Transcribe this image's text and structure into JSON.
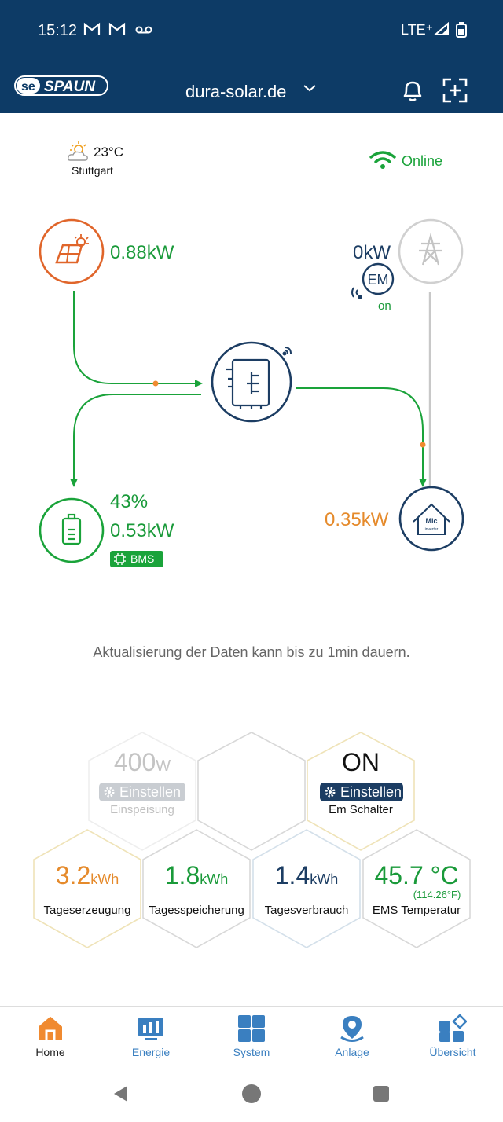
{
  "status": {
    "time": "15:12",
    "network": "LTE⁺"
  },
  "header": {
    "site": "dura-solar.de",
    "brand": "SPAUN"
  },
  "weather": {
    "temperature": "23°C",
    "city": "Stuttgart"
  },
  "connection": {
    "status": "Online"
  },
  "flow": {
    "pv_power": "0.88kW",
    "grid_power": "0kW",
    "em_label": "EM",
    "em_state": "on",
    "battery_soc": "43%",
    "battery_power": "0.53kW",
    "bms_label": "BMS",
    "home_power": "0.35kW",
    "home_icon_text": "Mic",
    "home_icon_sub": "inverter"
  },
  "note": "Aktualisierung der Daten kann bis zu 1min dauern.",
  "tiles": {
    "feed_in": {
      "value": "400",
      "unit": "W",
      "button": "Einstellen",
      "label": "Einspeisung"
    },
    "em_switch": {
      "value": "ON",
      "button": "Einstellen",
      "label": "Em Schalter"
    },
    "gen": {
      "value": "3.2",
      "unit": "kWh",
      "label": "Tageserzeugung"
    },
    "store": {
      "value": "1.8",
      "unit": "kWh",
      "label": "Tagesspeicherung"
    },
    "cons": {
      "value": "1.4",
      "unit": "kWh",
      "label": "Tagesverbrauch"
    },
    "ems_temp": {
      "value": "45.7 °C",
      "sub": "(114.26°F)",
      "label": "EMS Temperatur"
    }
  },
  "nav": [
    {
      "label": "Home",
      "icon": "home-icon"
    },
    {
      "label": "Energie",
      "icon": "energy-chart-icon"
    },
    {
      "label": "System",
      "icon": "grid-icon"
    },
    {
      "label": "Anlage",
      "icon": "location-icon"
    },
    {
      "label": "Übersicht",
      "icon": "overview-icon"
    }
  ],
  "colors": {
    "header": "#0d3b66",
    "green": "#1aa33a",
    "orange": "#e58a2b",
    "navy": "#1c3d63",
    "link": "#3a7fc0"
  }
}
